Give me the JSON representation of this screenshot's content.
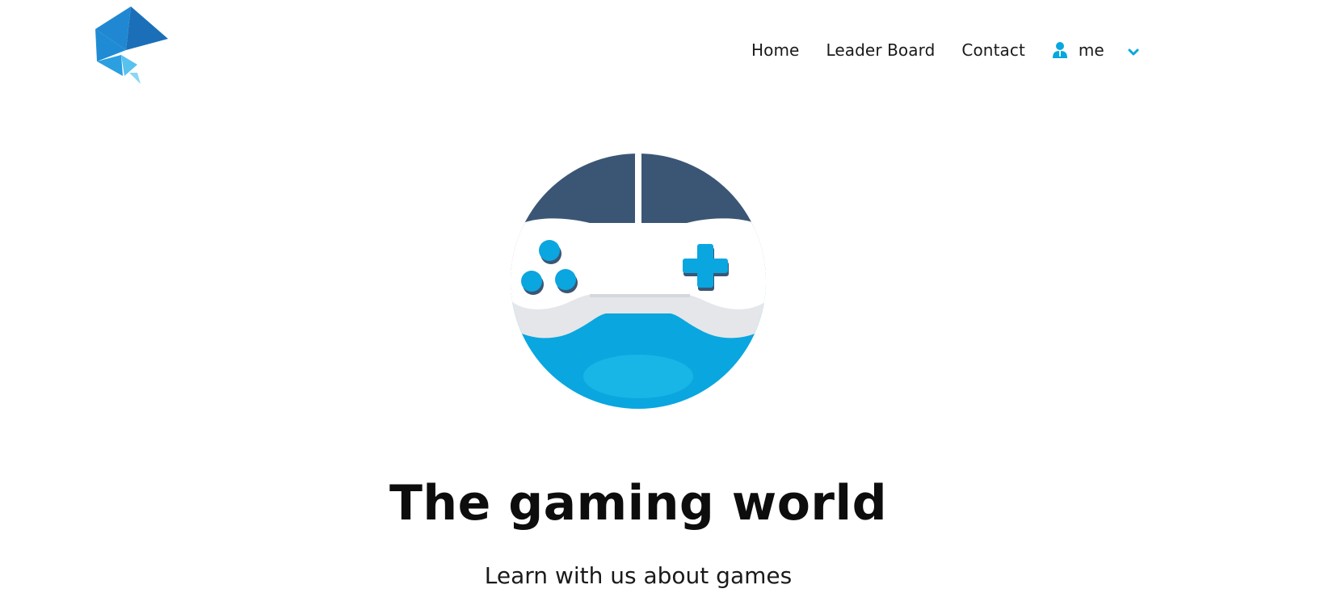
{
  "header": {
    "logo_icon": "polygon-logo-icon",
    "nav": {
      "home": "Home",
      "leaderboard": "Leader Board",
      "contact": "Contact"
    },
    "user": {
      "icon": "user-icon",
      "label": "me",
      "dropdown_icon": "chevron-down-icon"
    }
  },
  "hero": {
    "illustration_icon": "gamepad-icon",
    "title": "The gaming world",
    "subtitle": "Learn with us about games"
  },
  "colors": {
    "accent": "#0aa6df",
    "dark_blue": "#3b5675",
    "logo_blue": "#1a7dc8",
    "light_blue": "#4fc1ec",
    "controller_white": "#ffffff",
    "controller_grey": "#e4e6ea"
  }
}
